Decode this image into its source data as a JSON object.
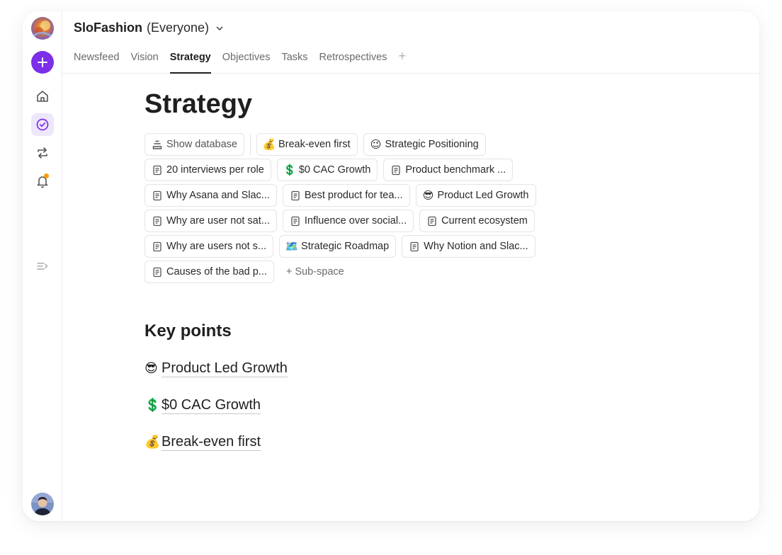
{
  "space": {
    "name": "SloFashion",
    "audience": "(Everyone)"
  },
  "tabs": [
    "Newsfeed",
    "Vision",
    "Strategy",
    "Objectives",
    "Tasks",
    "Retrospectives"
  ],
  "active_tab": "Strategy",
  "page": {
    "title": "Strategy"
  },
  "chips": {
    "show_database": "Show database",
    "items": [
      {
        "emoji": "💰",
        "label": "Break-even first"
      },
      {
        "emoji": "😉",
        "label": "Strategic Positioning"
      },
      {
        "icon": "doc",
        "label": "20 interviews per role"
      },
      {
        "emoji": "💲",
        "label": "$0 CAC Growth"
      },
      {
        "icon": "doc",
        "label": "Product benchmark ..."
      },
      {
        "icon": "doc",
        "label": "Why Asana and Slac..."
      },
      {
        "icon": "doc",
        "label": "Best product for tea..."
      },
      {
        "emoji": "😎",
        "label": "Product Led Growth"
      },
      {
        "icon": "doc",
        "label": "Why are user not sat..."
      },
      {
        "icon": "doc",
        "label": "Influence over social..."
      },
      {
        "icon": "doc",
        "label": "Current ecosystem"
      },
      {
        "icon": "doc",
        "label": "Why are users not s..."
      },
      {
        "emoji": "🗺️",
        "label": "Strategic Roadmap"
      },
      {
        "icon": "doc",
        "label": "Why Notion and Slac..."
      },
      {
        "icon": "doc",
        "label": "Causes of the bad p..."
      }
    ],
    "add_subspace": "+ Sub-space"
  },
  "key_points": {
    "title": "Key points",
    "items": [
      {
        "emoji": "😎",
        "label": "Product Led Growth"
      },
      {
        "emoji": "💲",
        "label": "$0 CAC Growth"
      },
      {
        "emoji": "💰",
        "label": "Break-even first"
      }
    ]
  },
  "colors": {
    "accent": "#7c2ee8",
    "notification": "#f59e0b",
    "active_nav_bg": "#ede7fb"
  }
}
